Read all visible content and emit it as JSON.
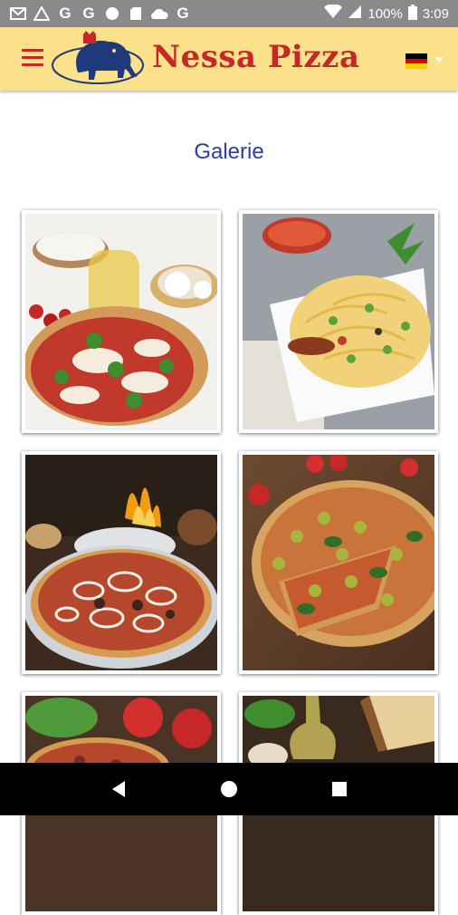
{
  "status_bar": {
    "notification_icons": [
      "gmail-icon",
      "drive-icon",
      "google-icon",
      "google-icon",
      "circle-icon",
      "sd-card-icon",
      "cloud-icon",
      "google-icon"
    ],
    "battery_text": "100%",
    "time": "3:09"
  },
  "app_bar": {
    "brand": "Nessa Pizza",
    "language_flag": "germany-flag-icon",
    "colors": {
      "background": "#fbe28a",
      "brand": "#c62828"
    }
  },
  "main": {
    "title": "Galerie",
    "gallery": [
      {
        "name": "gallery-image-margherita-pizza"
      },
      {
        "name": "gallery-image-pasta"
      },
      {
        "name": "gallery-image-onion-pizza"
      },
      {
        "name": "gallery-image-olive-pizza"
      },
      {
        "name": "gallery-image-pizza-tomatoes"
      },
      {
        "name": "gallery-image-ingredients"
      }
    ]
  }
}
